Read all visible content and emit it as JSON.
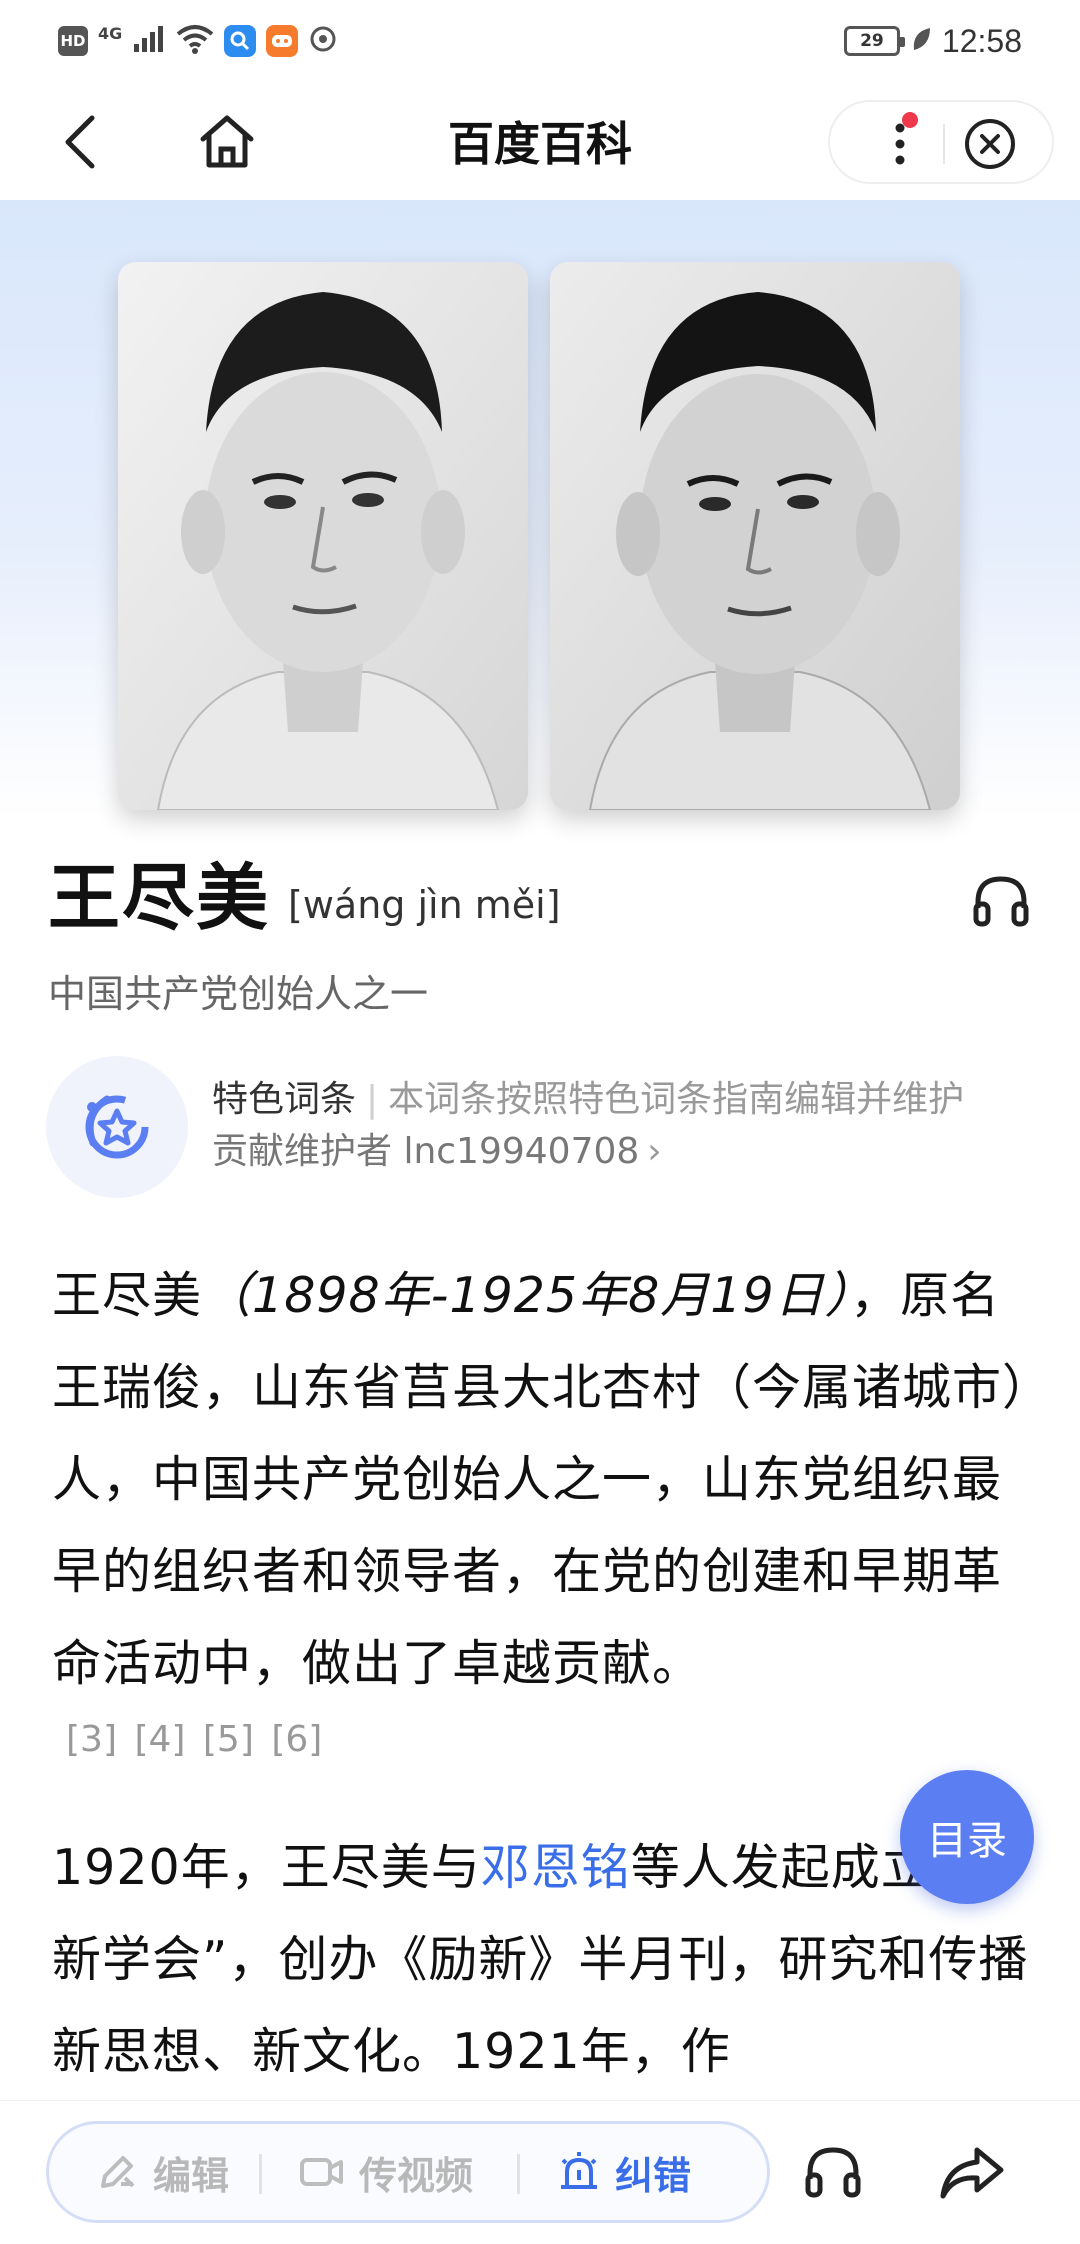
{
  "status_bar": {
    "hd_badge": "HD",
    "network": "4G",
    "battery": "29",
    "time": "12:58"
  },
  "nav": {
    "title": "百度百科"
  },
  "entry": {
    "title": "王尽美",
    "pinyin": "[wáng jìn měi]",
    "subtitle": "中国共产党创始人之一"
  },
  "feature": {
    "label": "特色词条",
    "separator": "|",
    "description": "本词条按照特色词条指南编辑并维护",
    "maintainer_text": "贡献维护者 lnc19940708",
    "chevron": "›"
  },
  "body": {
    "para1_a": "王尽美",
    "para1_date": "（1898年-1925年8月19日）",
    "para1_b": "，原名王瑞俊，山东省莒县大北杏村（今属诸城市）人，中国共产党创始人之一，山东党组织最早的组织者和领导者，在党的创建和早期革命活动中，做出了卓越贡献。",
    "refs": "[3] [4] [5] [6]",
    "para2_a": "1920年，王尽美与",
    "para2_link": "邓恩铭",
    "para2_b": "等人发起成立“励新学会”，创办《励新》半月刊，研究和传播新思想、新文化。1921年，作"
  },
  "toc": {
    "label": "目录"
  },
  "bottom_bar": {
    "edit_label": "编辑",
    "video_label": "传视频",
    "fix_label": "纠错"
  },
  "colors": {
    "accent_blue": "#3a6ee8",
    "toc_blue": "#5b7ef2",
    "notification_red": "#f0384d"
  }
}
